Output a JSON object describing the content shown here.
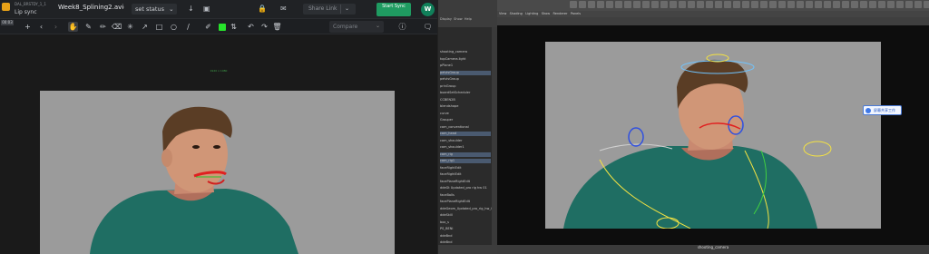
{
  "review_app": {
    "project_top": "DAL_BRSTDY_1_1",
    "project_name": "Lip sync",
    "file_name": "Week8_Splining2.avi",
    "status_label": "set status",
    "share_label": "Share Link",
    "sync_label": "Start Sync",
    "user_initial": "W",
    "frame_badge": "00:03",
    "compare_placeholder": "Compare",
    "annotation_color": "#27e32b",
    "canvas_label": "1920 x 1080"
  },
  "maya": {
    "outliner_menu": [
      "Display",
      "Show",
      "Help"
    ],
    "outliner_items": [
      {
        "label": "shooting_camera",
        "selected": false
      },
      {
        "label": "topCamera.light",
        "selected": false
      },
      {
        "label": "pPlane1",
        "selected": false
      },
      {
        "label": "pelvisGroup",
        "selected": true
      },
      {
        "label": "pelvisGroup",
        "selected": false
      },
      {
        "label": "prinGroup",
        "selected": false
      },
      {
        "label": "boardSetScheduler",
        "selected": false
      },
      {
        "label": "CCBEN2B",
        "selected": false
      },
      {
        "label": "blendshape",
        "selected": false
      },
      {
        "label": "curve",
        "selected": false
      },
      {
        "label": "Grouper",
        "selected": false
      },
      {
        "label": "cam_conventional",
        "selected": false
      },
      {
        "label": "cam_head",
        "selected": true
      },
      {
        "label": "cam_shoulder",
        "selected": false
      },
      {
        "label": "cam_shoulder1",
        "selected": false
      },
      {
        "label": "cam_rig",
        "selected": true
      },
      {
        "label": "cam_rig1",
        "selected": true
      },
      {
        "label": "faceRightEdit",
        "selected": false
      },
      {
        "label": "faceRightEdit",
        "selected": false
      },
      {
        "label": "facePlaneRightEdit",
        "selected": false
      },
      {
        "label": "ddeGt Updated_pro rig hw 01",
        "selected": false
      },
      {
        "label": "faceBalls",
        "selected": false
      },
      {
        "label": "facePlaneRightEdit",
        "selected": false
      },
      {
        "label": "ddeGeom_Updated_pro_rig_hw_01",
        "selected": false
      },
      {
        "label": "ddeSkill",
        "selected": false
      },
      {
        "label": "box_s",
        "selected": false
      },
      {
        "label": "PS_BENI",
        "selected": false
      },
      {
        "label": "ddeBnd",
        "selected": false
      },
      {
        "label": "ddeBnd",
        "selected": false
      }
    ],
    "viewport_menu": [
      "View",
      "Shading",
      "Lighting",
      "Show",
      "Renderer",
      "Panels"
    ],
    "camera_name": "shooting_camera",
    "popup_text": "屏幕共享工作"
  }
}
